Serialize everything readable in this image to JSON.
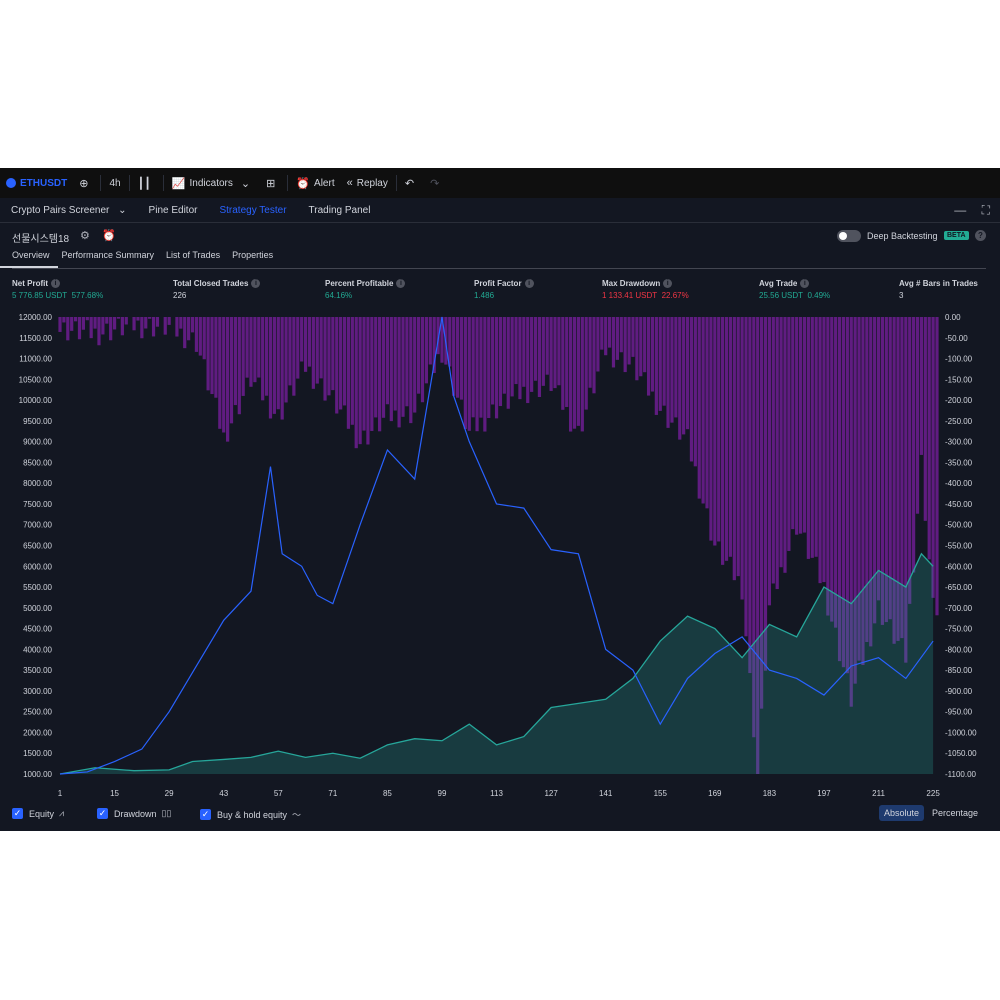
{
  "toolbar": {
    "symbol": "ETHUSDT",
    "interval": "4h",
    "indicators_label": "Indicators",
    "alert_label": "Alert",
    "replay_label": "Replay"
  },
  "panel_tabs": [
    {
      "label": "Crypto Pairs Screener",
      "active": false
    },
    {
      "label": "Pine Editor",
      "active": false
    },
    {
      "label": "Strategy Tester",
      "active": true
    },
    {
      "label": "Trading Panel",
      "active": false
    }
  ],
  "strategy": {
    "name": "선물시스템18",
    "deep_backtesting_label": "Deep Backtesting",
    "beta_badge": "BETA"
  },
  "sub_tabs": [
    {
      "label": "Overview",
      "active": true
    },
    {
      "label": "Performance Summary",
      "active": false
    },
    {
      "label": "List of Trades",
      "active": false
    },
    {
      "label": "Properties",
      "active": false
    }
  ],
  "metrics": {
    "net_profit": {
      "label": "Net Profit",
      "value": "5 776.85 USDT",
      "pct": "577.68%"
    },
    "total_closed_trades": {
      "label": "Total Closed Trades",
      "value": "226"
    },
    "percent_profitable": {
      "label": "Percent Profitable",
      "value": "64.16%"
    },
    "profit_factor": {
      "label": "Profit Factor",
      "value": "1.486"
    },
    "max_drawdown": {
      "label": "Max Drawdown",
      "value": "1 133.41 USDT",
      "pct": "22.67%"
    },
    "avg_trade": {
      "label": "Avg Trade",
      "value": "25.56 USDT",
      "pct": "0.49%"
    },
    "avg_bars": {
      "label": "Avg # Bars in Trades",
      "value": "3"
    }
  },
  "legend": {
    "equity_label": "Equity",
    "drawdown_label": "Drawdown",
    "buyhold_label": "Buy & hold equity",
    "absolute_label": "Absolute",
    "percentage_label": "Percentage"
  },
  "colors": {
    "equity": "#26a69a",
    "buyhold": "#2962ff",
    "drawdown": "#7b1fa2",
    "background": "#131722"
  },
  "chart_data": {
    "type": "line",
    "x_ticks": [
      1,
      15,
      29,
      43,
      57,
      71,
      85,
      99,
      113,
      127,
      141,
      155,
      169,
      183,
      197,
      211,
      225
    ],
    "y_left_ticks": [
      "12000.00",
      "11500.00",
      "11000.00",
      "10500.00",
      "10000.00",
      "9500.00",
      "9000.00",
      "8500.00",
      "8000.00",
      "7500.00",
      "7000.00",
      "6500.00",
      "6000.00",
      "5500.00",
      "5000.00",
      "4500.00",
      "4000.00",
      "3500.00",
      "3000.00",
      "2500.00",
      "2000.00",
      "1500.00",
      "1000.00"
    ],
    "y_right_ticks": [
      "0.00",
      "-50.00",
      "-100.00",
      "-150.00",
      "-200.00",
      "-250.00",
      "-300.00",
      "-350.00",
      "-400.00",
      "-450.00",
      "-500.00",
      "-550.00",
      "-600.00",
      "-650.00",
      "-700.00",
      "-750.00",
      "-800.00",
      "-850.00",
      "-900.00",
      "-950.00",
      "-1000.00",
      "-1050.00",
      "-1100.00"
    ],
    "ylim_left": [
      1000,
      12000
    ],
    "ylim_right": [
      -1100,
      0
    ],
    "xlim": [
      1,
      226
    ],
    "series": [
      {
        "name": "Equity",
        "points": [
          [
            1,
            1000
          ],
          [
            10,
            1150
          ],
          [
            20,
            1080
          ],
          [
            29,
            1100
          ],
          [
            35,
            1300
          ],
          [
            43,
            1350
          ],
          [
            50,
            1400
          ],
          [
            57,
            1550
          ],
          [
            64,
            1400
          ],
          [
            71,
            1500
          ],
          [
            78,
            1380
          ],
          [
            85,
            1700
          ],
          [
            92,
            1850
          ],
          [
            99,
            1800
          ],
          [
            106,
            2200
          ],
          [
            113,
            1700
          ],
          [
            120,
            1900
          ],
          [
            127,
            2600
          ],
          [
            134,
            2700
          ],
          [
            141,
            2800
          ],
          [
            148,
            3300
          ],
          [
            155,
            4200
          ],
          [
            162,
            4800
          ],
          [
            169,
            4500
          ],
          [
            176,
            3800
          ],
          [
            183,
            4600
          ],
          [
            190,
            4300
          ],
          [
            197,
            5500
          ],
          [
            204,
            5100
          ],
          [
            211,
            5900
          ],
          [
            218,
            5500
          ],
          [
            222,
            6300
          ],
          [
            225,
            6000
          ]
        ]
      },
      {
        "name": "Buy & hold equity",
        "points": [
          [
            1,
            1000
          ],
          [
            8,
            1050
          ],
          [
            15,
            1300
          ],
          [
            22,
            1600
          ],
          [
            29,
            2500
          ],
          [
            36,
            3600
          ],
          [
            43,
            4700
          ],
          [
            50,
            5400
          ],
          [
            55,
            8400
          ],
          [
            58,
            6300
          ],
          [
            63,
            6000
          ],
          [
            67,
            5300
          ],
          [
            71,
            5100
          ],
          [
            78,
            7000
          ],
          [
            85,
            8800
          ],
          [
            92,
            8100
          ],
          [
            99,
            12000
          ],
          [
            102,
            10100
          ],
          [
            106,
            9000
          ],
          [
            113,
            7500
          ],
          [
            120,
            7400
          ],
          [
            127,
            6400
          ],
          [
            134,
            6300
          ],
          [
            141,
            4000
          ],
          [
            148,
            3500
          ],
          [
            155,
            2200
          ],
          [
            162,
            3300
          ],
          [
            169,
            3900
          ],
          [
            176,
            4300
          ],
          [
            183,
            3500
          ],
          [
            190,
            3300
          ],
          [
            197,
            2900
          ],
          [
            204,
            3600
          ],
          [
            211,
            3800
          ],
          [
            218,
            3300
          ],
          [
            225,
            4200
          ]
        ]
      }
    ],
    "drawdown_points": [
      [
        1,
        -30
      ],
      [
        10,
        -40
      ],
      [
        20,
        -20
      ],
      [
        29,
        -25
      ],
      [
        36,
        -60
      ],
      [
        43,
        -290
      ],
      [
        50,
        -150
      ],
      [
        57,
        -240
      ],
      [
        64,
        -120
      ],
      [
        71,
        -200
      ],
      [
        78,
        -300
      ],
      [
        85,
        -240
      ],
      [
        92,
        -230
      ],
      [
        99,
        -80
      ],
      [
        106,
        -280
      ],
      [
        113,
        -220
      ],
      [
        120,
        -180
      ],
      [
        127,
        -160
      ],
      [
        134,
        -280
      ],
      [
        141,
        -80
      ],
      [
        148,
        -120
      ],
      [
        155,
        -220
      ],
      [
        162,
        -300
      ],
      [
        169,
        -550
      ],
      [
        176,
        -650
      ],
      [
        180,
        -1100
      ],
      [
        183,
        -700
      ],
      [
        190,
        -500
      ],
      [
        197,
        -650
      ],
      [
        204,
        -920
      ],
      [
        211,
        -700
      ],
      [
        218,
        -820
      ],
      [
        222,
        -350
      ],
      [
        225,
        -700
      ]
    ]
  }
}
